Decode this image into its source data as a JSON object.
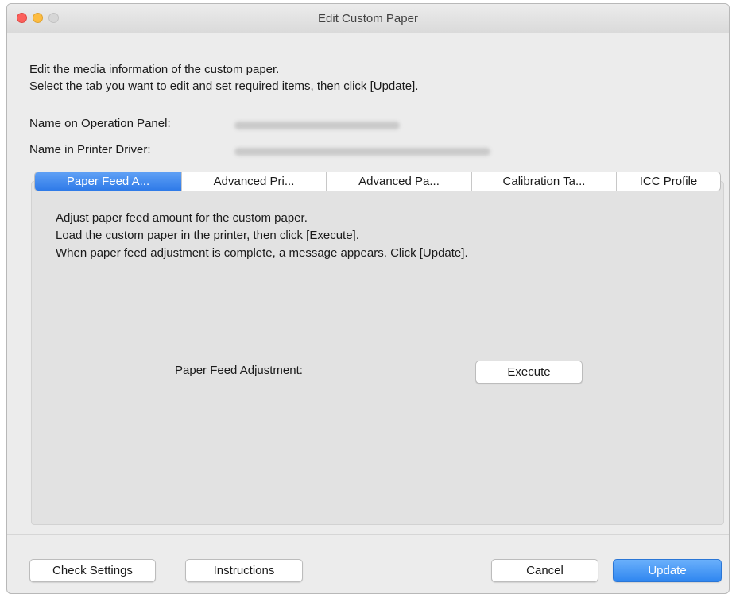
{
  "window": {
    "title": "Edit Custom Paper"
  },
  "description": {
    "line1": "Edit the media information of the custom paper.",
    "line2": "Select the tab you want to edit and set required items, then click [Update]."
  },
  "fields": {
    "operation_panel_label": "Name on Operation Panel:",
    "printer_driver_label": "Name in Printer Driver:"
  },
  "tabs": [
    {
      "label": "Paper Feed A...",
      "active": true
    },
    {
      "label": "Advanced Pri...",
      "active": false
    },
    {
      "label": "Advanced Pa...",
      "active": false
    },
    {
      "label": "Calibration Ta...",
      "active": false
    },
    {
      "label": "ICC Profile",
      "active": false
    }
  ],
  "panel": {
    "line1": "Adjust paper feed amount for the custom paper.",
    "line2": "Load the custom paper in the printer, then click [Execute].",
    "line3": "When paper feed adjustment is complete, a message appears. Click [Update].",
    "adjustment_label": "Paper Feed Adjustment:",
    "execute_label": "Execute"
  },
  "footer": {
    "check_settings_label": "Check Settings",
    "instructions_label": "Instructions",
    "cancel_label": "Cancel",
    "update_label": "Update"
  },
  "colors": {
    "accent": "#2e7ae8",
    "close": "#fc605c",
    "minimize": "#fdbc40",
    "window_bg": "#ececec",
    "panel_bg": "#e2e2e2"
  },
  "icons": [
    "close-icon",
    "minimize-icon",
    "zoom-icon"
  ]
}
